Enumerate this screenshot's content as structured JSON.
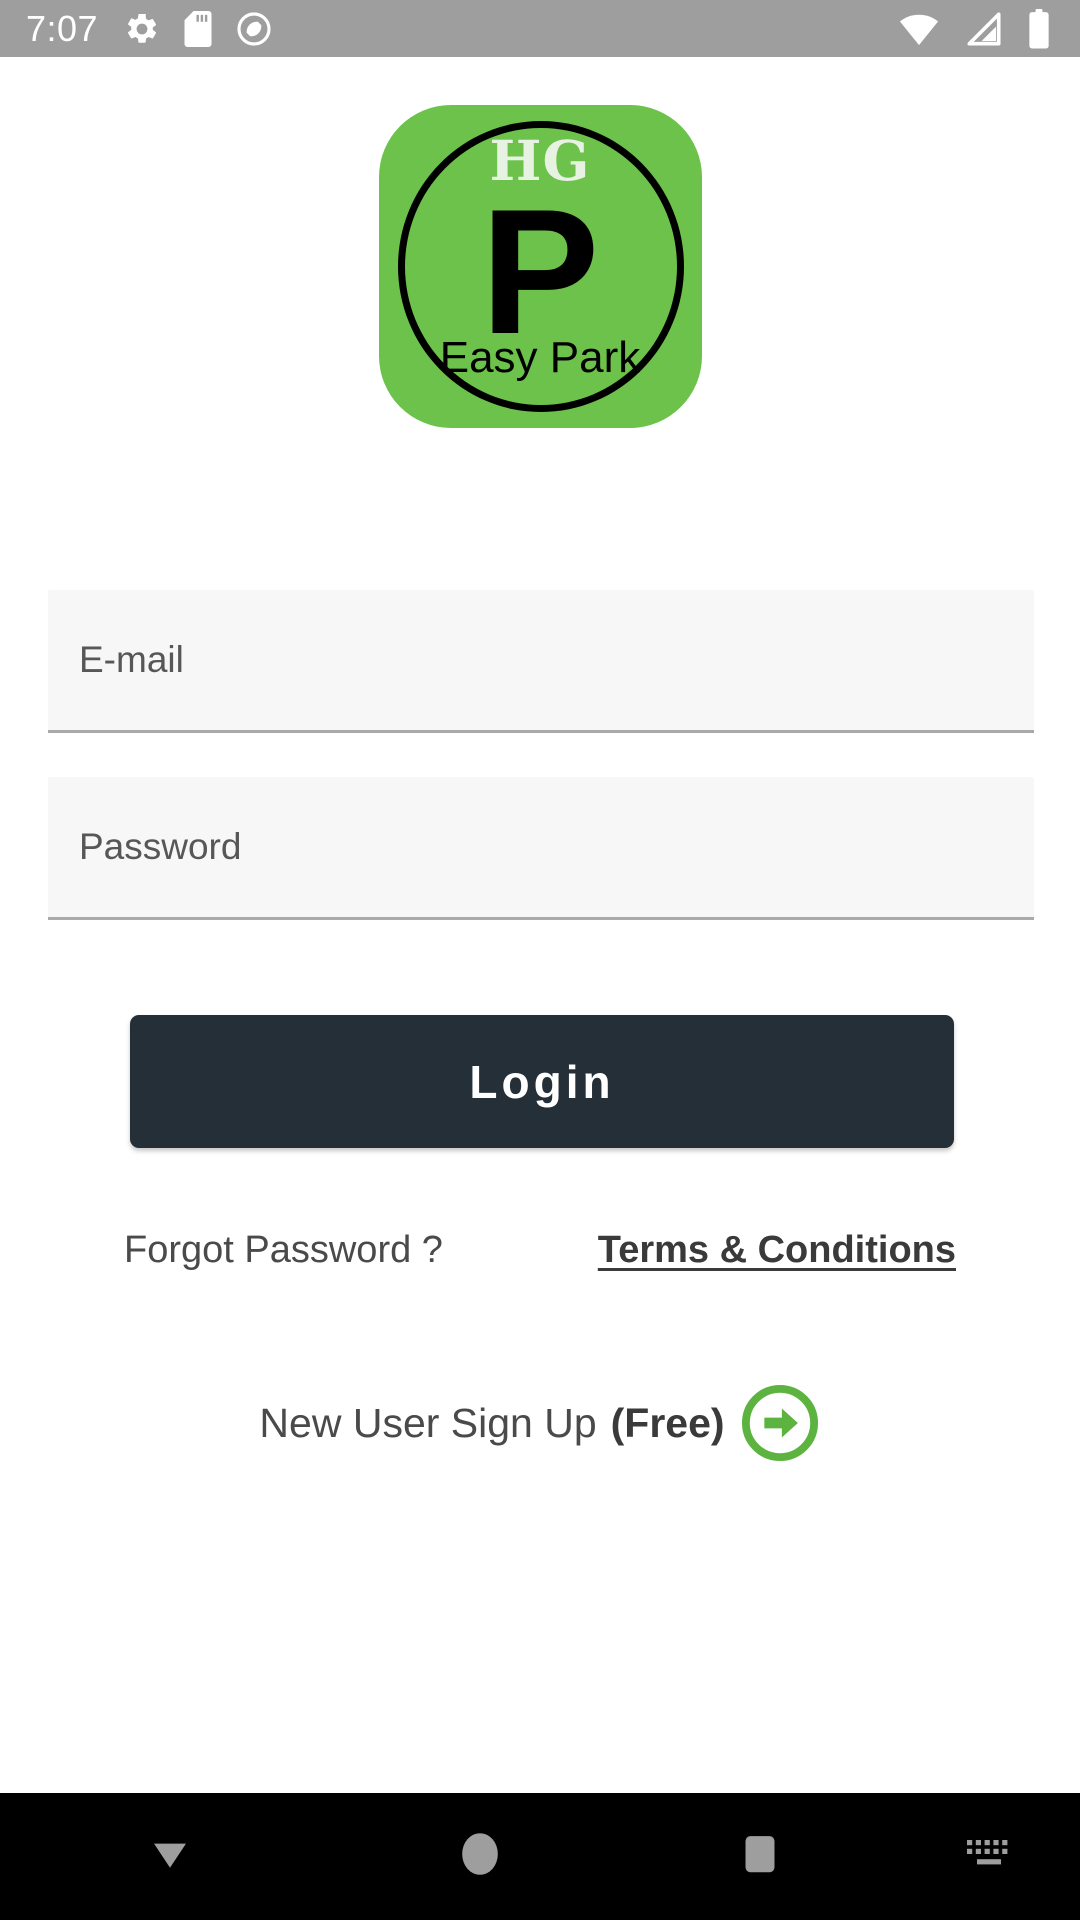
{
  "status_bar": {
    "time": "7:07",
    "background_color": "#9e9e9e",
    "icon_color": "#ffffff",
    "left_icons": [
      "gear-icon",
      "sd-card-icon",
      "do-not-disturb-icon"
    ],
    "right_icons": [
      "wifi-icon",
      "cellular-signal-icon",
      "battery-icon"
    ]
  },
  "logo": {
    "brand_mark": "HG",
    "letter": "P",
    "tagline": "Easy Park",
    "background_color": "#6cc24a",
    "ring_color": "#000000",
    "mark_color": "#e8f2e2"
  },
  "form": {
    "email": {
      "placeholder": "E-mail",
      "value": ""
    },
    "password": {
      "placeholder": "Password",
      "value": ""
    },
    "login_label": "Login",
    "login_color": "#242f38"
  },
  "links": {
    "forgot_password": "Forgot Password ?",
    "terms": "Terms & Conditions"
  },
  "signup": {
    "text": "New User Sign Up",
    "free_label": "(Free)",
    "arrow_color": "#5cb340"
  },
  "nav_bar": {
    "background_color": "#000000",
    "icon_color": "#9e9e9e",
    "items": [
      "back-icon",
      "home-icon",
      "recents-icon",
      "keyboard-icon"
    ]
  }
}
